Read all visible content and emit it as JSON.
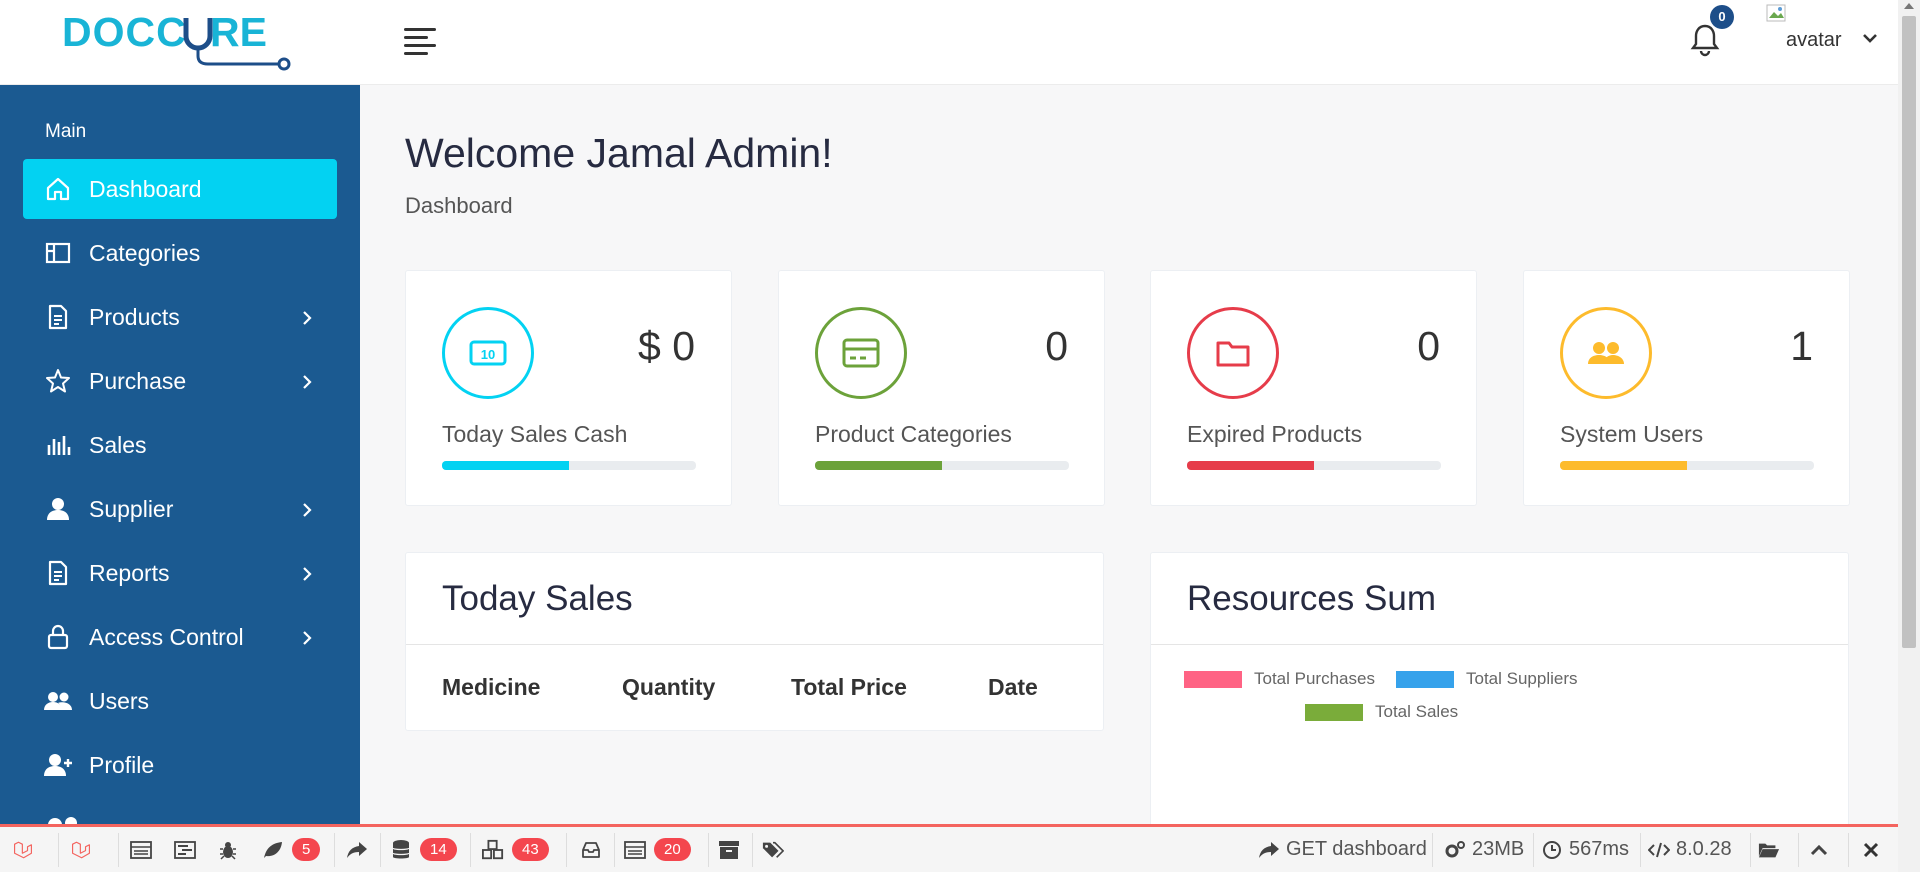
{
  "brand": {
    "name": "DOCCURE"
  },
  "header": {
    "notification_count": "0",
    "avatar_alt": "avatar",
    "avatar_label": "avatar"
  },
  "sidebar": {
    "section_title": "Main",
    "items": [
      {
        "label": "Dashboard",
        "icon": "home-icon",
        "active": true,
        "has_submenu": false
      },
      {
        "label": "Categories",
        "icon": "layout-icon",
        "has_submenu": false
      },
      {
        "label": "Products",
        "icon": "document-icon",
        "has_submenu": true
      },
      {
        "label": "Purchase",
        "icon": "star-icon",
        "has_submenu": true
      },
      {
        "label": "Sales",
        "icon": "bar-chart-icon",
        "has_submenu": false
      },
      {
        "label": "Supplier",
        "icon": "user-icon",
        "has_submenu": true
      },
      {
        "label": "Reports",
        "icon": "document-icon",
        "has_submenu": true
      },
      {
        "label": "Access Control",
        "icon": "lock-icon",
        "has_submenu": true
      },
      {
        "label": "Users",
        "icon": "users-icon",
        "has_submenu": false
      },
      {
        "label": "Profile",
        "icon": "user-plus-icon",
        "has_submenu": false
      }
    ]
  },
  "page": {
    "title": "Welcome Jamal Admin!",
    "breadcrumb": "Dashboard"
  },
  "stats": [
    {
      "value": "$ 0",
      "label": "Today Sales Cash",
      "icon": "money-icon",
      "color": "#03d2f2",
      "progress": 0.5
    },
    {
      "value": "0",
      "label": "Product Categories",
      "icon": "credit-card-icon",
      "color": "#6ca23a",
      "progress": 0.5
    },
    {
      "value": "0",
      "label": "Expired Products",
      "icon": "folder-icon",
      "color": "#e63c4a",
      "progress": 0.5
    },
    {
      "value": "1",
      "label": "System Users",
      "icon": "users-icon",
      "color": "#fdbb2c",
      "progress": 0.5
    }
  ],
  "today_sales": {
    "title": "Today Sales",
    "columns": [
      "Medicine",
      "Quantity",
      "Total Price",
      "Date"
    ]
  },
  "resources": {
    "title": "Resources Sum",
    "legend": [
      {
        "label": "Total Purchases",
        "color": "#ff6384"
      },
      {
        "label": "Total Suppliers",
        "color": "#36a2eb"
      },
      {
        "label": "Total Sales",
        "color": "#7aac3a"
      }
    ]
  },
  "debugbar": {
    "badges": {
      "messages": "5",
      "queries": "14",
      "models": "43",
      "views": "20"
    },
    "route": "GET dashboard",
    "memory": "23MB",
    "time": "567ms",
    "php_version": "8.0.28"
  }
}
